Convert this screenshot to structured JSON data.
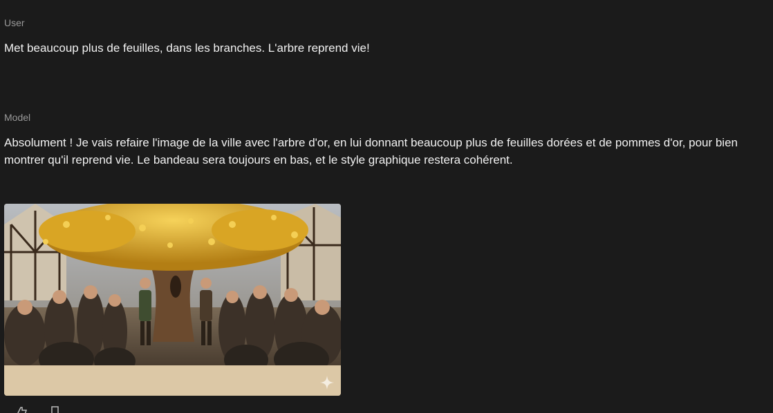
{
  "conversation": {
    "user": {
      "role_label": "User",
      "message": "Met beaucoup plus de feuilles, dans les branches. L'arbre reprend vie!"
    },
    "model": {
      "role_label": "Model",
      "message": "Absolument ! Je vais refaire l'image de la ville avec l'arbre d'or, en lui donnant beaucoup plus de feuilles dorées et de pommes d'or, pour bien montrer qu'il reprend vie. Le bandeau sera toujours en bas, et le style graphique restera cohérent."
    }
  },
  "image": {
    "banner_color": "#dcc8a6",
    "sparkle_icon": "sparkle-icon",
    "foliage_color": "#e8b52a",
    "trunk_color": "#6b4a2e"
  },
  "toolbar": {
    "icons": [
      "thumbs-icon",
      "copy-icon"
    ]
  }
}
